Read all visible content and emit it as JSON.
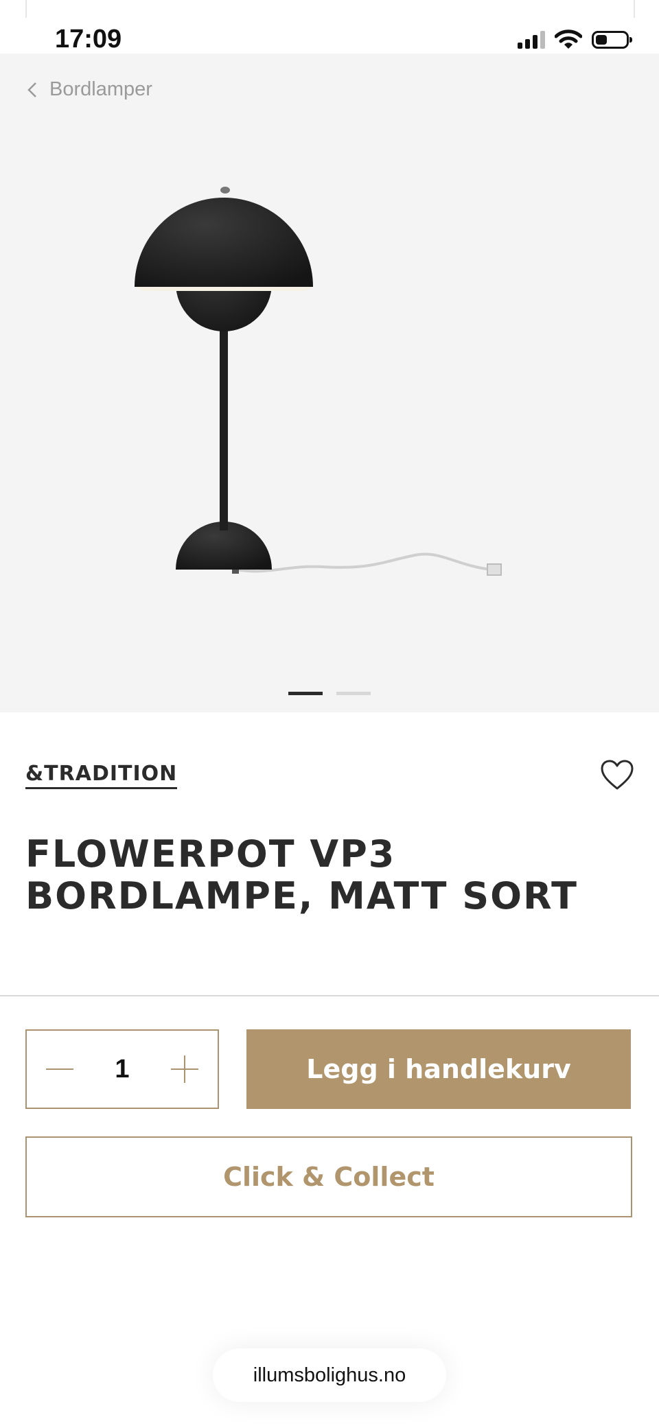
{
  "status_bar": {
    "time": "17:09"
  },
  "breadcrumb": {
    "label": "Bordlamper"
  },
  "gallery": {
    "image_count": 2,
    "active_index": 0
  },
  "product": {
    "brand": "&TRADITION",
    "title": "FLOWERPOT VP3 BORDLAMPE, MATT SORT"
  },
  "purchase": {
    "quantity": "1",
    "add_to_cart_label": "Legg i handlekurv",
    "click_collect_label": "Click & Collect"
  },
  "browser": {
    "url": "illumsbolighus.no"
  },
  "colors": {
    "accent": "#b0956d",
    "text": "#2b2b2b",
    "hero_bg": "#f4f4f4"
  },
  "icons": {
    "back": "chevron-left-icon",
    "favorite": "heart-icon",
    "decrement": "minus-icon",
    "increment": "plus-icon"
  }
}
